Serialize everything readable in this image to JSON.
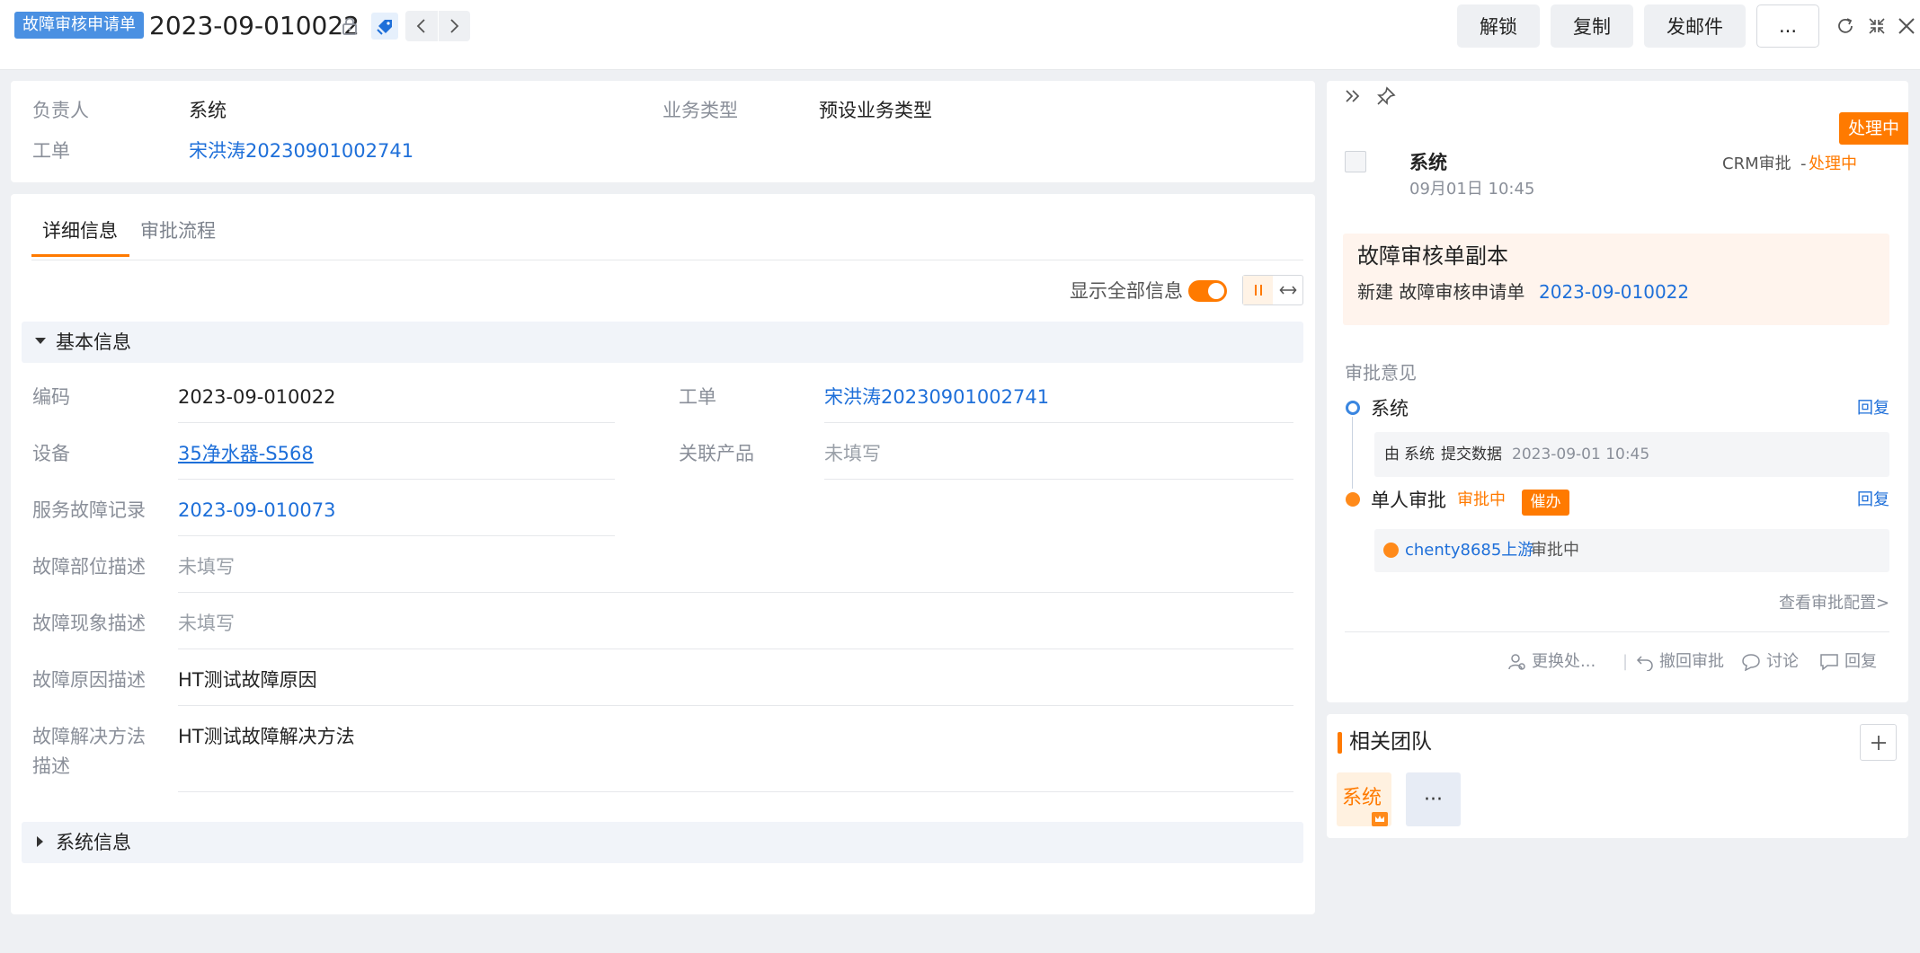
{
  "header": {
    "tag": "故障审核申请单",
    "record_no": "2023-09-010022",
    "actions": {
      "unlock": "解锁",
      "copy": "复制",
      "email": "发邮件",
      "more": "..."
    }
  },
  "summary": {
    "owner_label": "负责人",
    "owner_value": "系统",
    "biz_type_label": "业务类型",
    "biz_type_value": "预设业务类型",
    "work_order_label": "工单",
    "work_order_value": "宋洪涛20230901002741"
  },
  "tabs": {
    "detail": "详细信息",
    "approval": "审批流程"
  },
  "show_all": {
    "label": "显示全部信息",
    "on": true
  },
  "basic": {
    "title": "基本信息",
    "fields": {
      "code": {
        "label": "编码",
        "value": "2023-09-010022"
      },
      "work_order": {
        "label": "工单",
        "value": "宋洪涛20230901002741"
      },
      "device": {
        "label": "设备",
        "value": "35净水器-S568"
      },
      "related_product": {
        "label": "关联产品",
        "value": "未填写"
      },
      "service_record": {
        "label": "服务故障记录",
        "value": "2023-09-010073"
      },
      "part_desc": {
        "label": "故障部位描述",
        "value": "未填写"
      },
      "symptom_desc": {
        "label": "故障现象描述",
        "value": "未填写"
      },
      "cause_desc": {
        "label": "故障原因描述",
        "value": "HT测试故障原因"
      },
      "solution_desc": {
        "label_1": "故障解决方法",
        "label_2": "描述",
        "value": "HT测试故障解决方法"
      }
    }
  },
  "system_section": {
    "title": "系统信息"
  },
  "side": {
    "status_corner": "处理中",
    "submitter": "系统",
    "time": "09月01日 10:45",
    "type": "CRM审批",
    "sep": "-",
    "type_status": "处理中",
    "notice": {
      "title": "故障审核单副本",
      "prefix": "新建 故障审核申请单",
      "link": "2023-09-010022"
    },
    "opinion_title": "审批意见",
    "steps": [
      {
        "name": "系统",
        "reply": "回复",
        "detail_prefix": "由",
        "detail_who": "系统",
        "detail_action": "提交数据",
        "detail_time": "2023-09-01 10:45"
      },
      {
        "name": "单人审批",
        "status": "审批中",
        "urge": "催办",
        "reply": "回复",
        "approver": "chenty8685上游",
        "approver_status": "审批中"
      }
    ],
    "view_config": "查看审批配置>",
    "footer": {
      "change": "更换处...",
      "divider": "|",
      "revoke": "撤回审批",
      "discuss": "讨论",
      "reply": "回复"
    }
  },
  "team": {
    "title": "相关团队",
    "member": "系统",
    "more": "···"
  },
  "colors": {
    "accent": "#ff7a00",
    "link": "#1e6fd9",
    "tag": "#4a90e2"
  }
}
